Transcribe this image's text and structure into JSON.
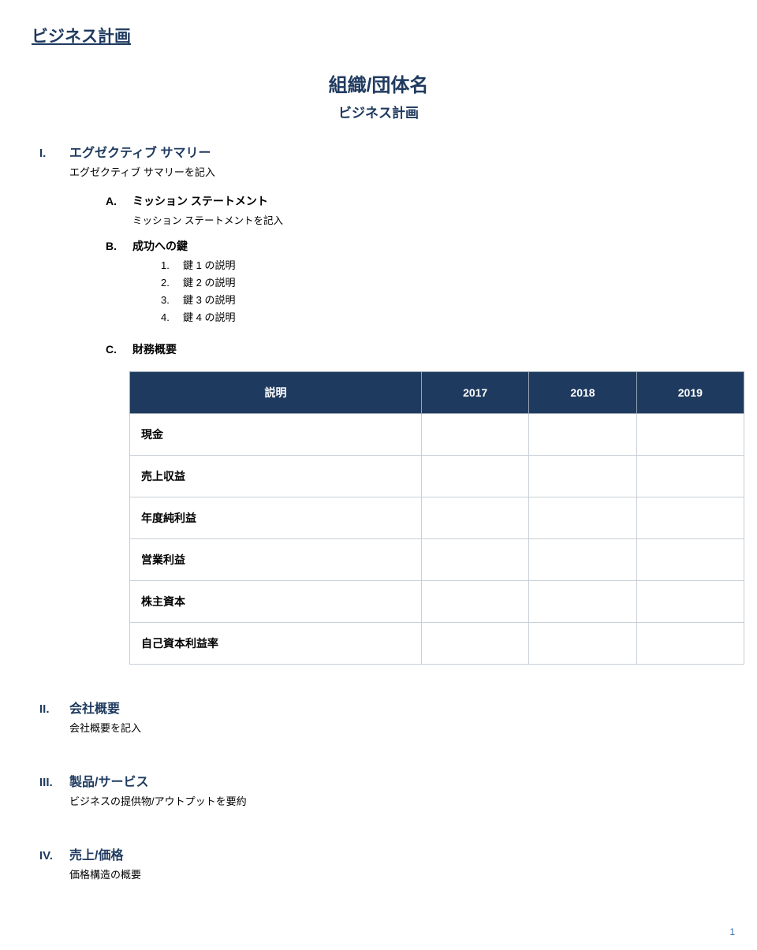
{
  "header": "ビジネス計画",
  "title": {
    "org": "組織/団体名",
    "subtitle": "ビジネス計画"
  },
  "sections": {
    "s1": {
      "num": "I.",
      "title": "エグゼクティブ サマリー",
      "note": "エグゼクティブ サマリーを記入",
      "a": {
        "letter": "A.",
        "title": "ミッション ステートメント",
        "note": "ミッション ステートメントを記入"
      },
      "b": {
        "letter": "B.",
        "title": "成功への鍵",
        "items": [
          {
            "n": "1.",
            "t": "鍵 1 の説明"
          },
          {
            "n": "2.",
            "t": "鍵 2 の説明"
          },
          {
            "n": "3.",
            "t": "鍵 3 の説明"
          },
          {
            "n": "4.",
            "t": "鍵 4 の説明"
          }
        ]
      },
      "c": {
        "letter": "C.",
        "title": "財務概要"
      }
    },
    "s2": {
      "num": "II.",
      "title": "会社概要",
      "note": "会社概要を記入"
    },
    "s3": {
      "num": "III.",
      "title": "製品/サービス",
      "note": "ビジネスの提供物/アウトプットを要約"
    },
    "s4": {
      "num": "IV.",
      "title": "売上/価格",
      "note": "価格構造の概要"
    }
  },
  "table": {
    "headers": [
      "説明",
      "2017",
      "2018",
      "2019"
    ],
    "rows": [
      {
        "label": "現金",
        "y1": "",
        "y2": "",
        "y3": ""
      },
      {
        "label": "売上収益",
        "y1": "",
        "y2": "",
        "y3": ""
      },
      {
        "label": "年度純利益",
        "y1": "",
        "y2": "",
        "y3": ""
      },
      {
        "label": "営業利益",
        "y1": "",
        "y2": "",
        "y3": ""
      },
      {
        "label": "株主資本",
        "y1": "",
        "y2": "",
        "y3": ""
      },
      {
        "label": "自己資本利益率",
        "y1": "",
        "y2": "",
        "y3": ""
      }
    ]
  },
  "pageNumber": "1"
}
